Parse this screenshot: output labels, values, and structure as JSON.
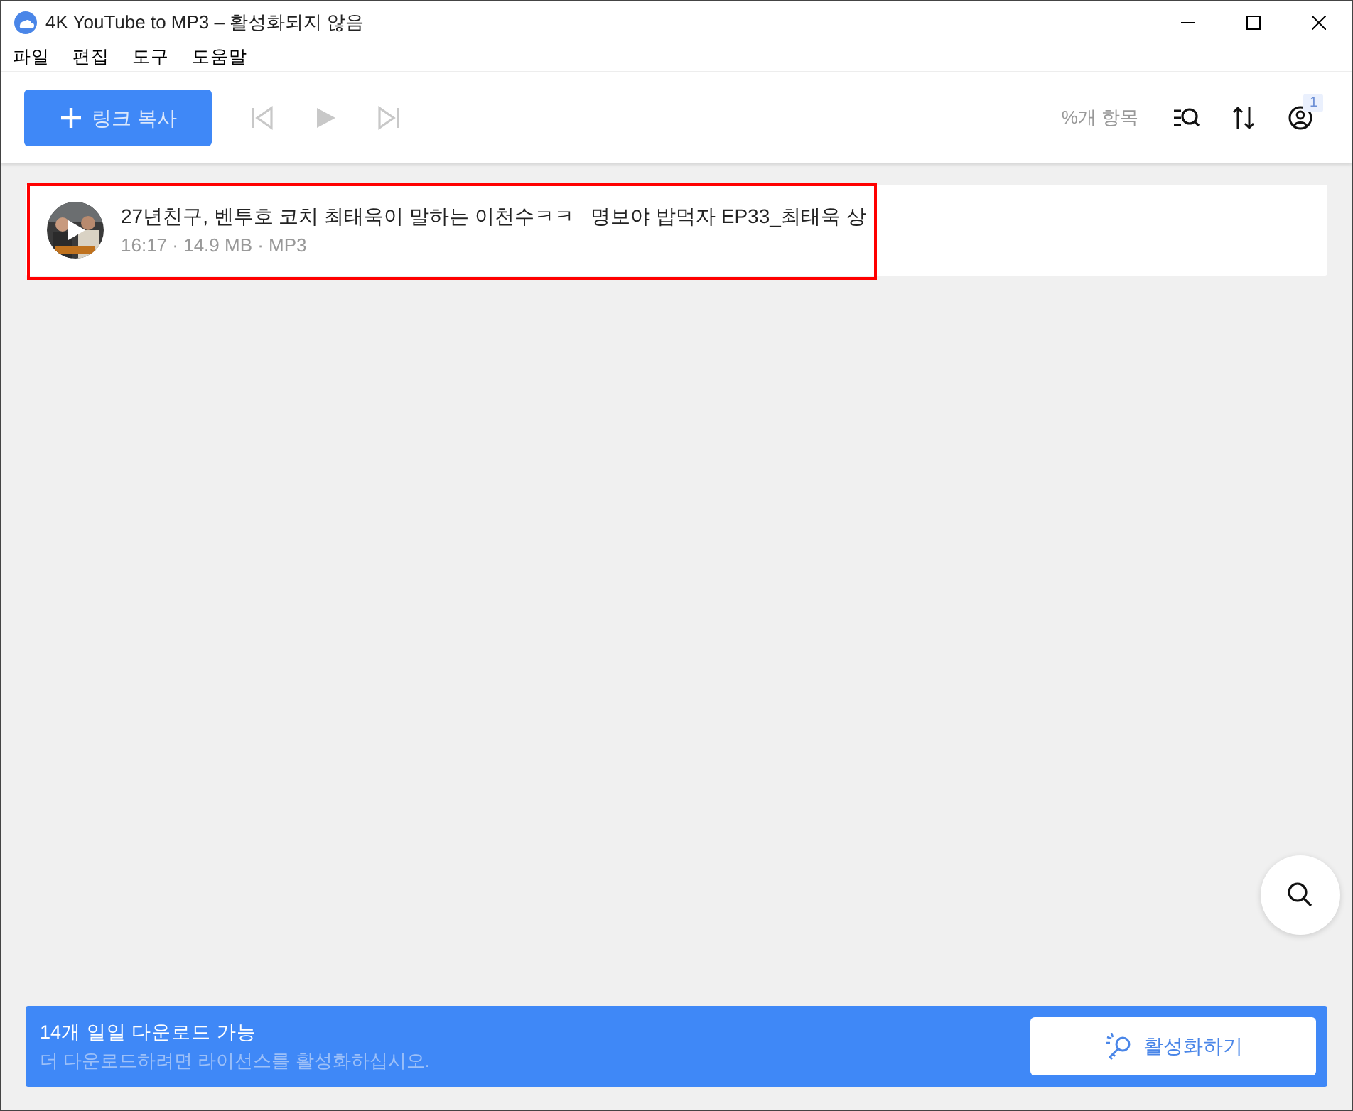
{
  "window": {
    "title": "4K YouTube to MP3 – 활성화되지 않음"
  },
  "menu": [
    "파일",
    "편집",
    "도구",
    "도움말"
  ],
  "toolbar": {
    "paste_button": "링크 복사",
    "player": [
      {
        "kind": "previous",
        "disabled": true
      },
      {
        "kind": "play",
        "disabled": true
      },
      {
        "kind": "next",
        "disabled": true
      }
    ],
    "item_count": "%개 항목",
    "account_badge": "1"
  },
  "items": [
    {
      "title": "27년친구, 벤투호 코치 최태욱이 말하는 이천수ㅋㅋ   명보야 밥먹자 EP33_최태욱 상",
      "meta": "16:17 · 14.9 MB · MP3",
      "highlighted": true
    }
  ],
  "footer": {
    "headline": "14개 일일 다운로드 가능",
    "note": "더 다운로드하려면 라이선스를 활성화하십시오.",
    "activate_button": "활성화하기"
  }
}
